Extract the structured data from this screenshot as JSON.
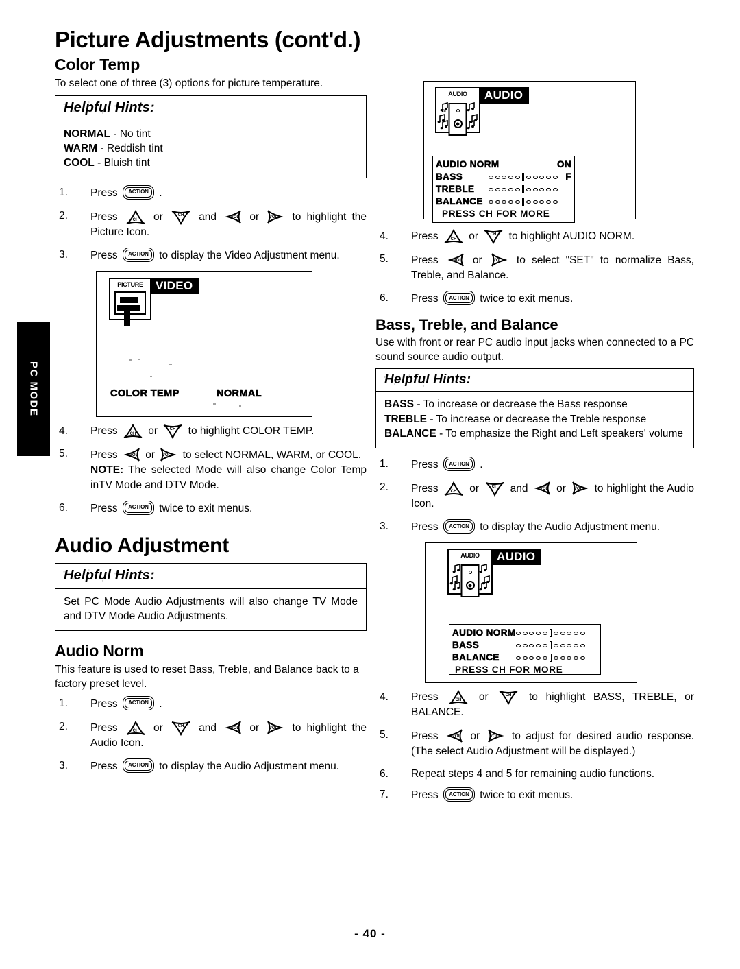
{
  "page": {
    "title": "Picture Adjustments (cont'd.)",
    "number": "- 40 -",
    "side_tab": "PC MODE"
  },
  "color_temp": {
    "heading": "Color Temp",
    "intro": "To select one of three (3) options for picture temperature.",
    "hints": {
      "title": "Helpful Hints:",
      "lines": [
        {
          "term": "NORMAL",
          "dash": "-",
          "desc": "No tint"
        },
        {
          "term": "WARM",
          "dash": "-",
          "desc": "Reddish tint"
        },
        {
          "term": "COOL",
          "dash": "-",
          "desc": "Bluish tint"
        }
      ]
    },
    "steps": [
      {
        "num": "1.",
        "pre": "Press",
        "icons": [
          "action"
        ],
        "post": "."
      },
      {
        "num": "2.",
        "pre": "Press",
        "icons": [
          "ch-up",
          "or",
          "ch-down",
          "and",
          "vol-left",
          "or",
          "vol-right"
        ],
        "post": "to highlight the Picture Icon."
      },
      {
        "num": "3.",
        "pre": "Press",
        "icons": [
          "action"
        ],
        "post": "to display the Video Adjustment menu."
      },
      {
        "num": "4.",
        "pre": "Press",
        "icons": [
          "ch-up",
          "or",
          "ch-down"
        ],
        "post": "to highlight COLOR TEMP."
      },
      {
        "num": "5.",
        "pre": "Press",
        "icons": [
          "vol-left",
          "or",
          "vol-right"
        ],
        "post": "to select NORMAL, WARM, or COOL.",
        "note_label": "NOTE:",
        "note": "The selected Mode will also change Color Temp inTV Mode and DTV Mode."
      },
      {
        "num": "6.",
        "pre": "Press",
        "icons": [
          "action"
        ],
        "post": "twice to exit menus."
      }
    ]
  },
  "video_menu": {
    "icon_caption": "PICTURE",
    "menu_title": "VIDEO",
    "item_label": "COLOR TEMP",
    "item_value": "NORMAL"
  },
  "audio_menu_1": {
    "icon_caption": "AUDIO",
    "menu_title": "AUDIO",
    "rows": [
      {
        "label": "AUDIO NORM",
        "bar": false,
        "value": "ON"
      },
      {
        "label": "BASS",
        "bar": true,
        "value": "F"
      },
      {
        "label": "TREBLE",
        "bar": true,
        "value": ""
      },
      {
        "label": "BALANCE",
        "bar": true,
        "value": ""
      }
    ],
    "footer": "PRESS  CH  FOR MORE"
  },
  "audio_menu_2": {
    "icon_caption": "AUDIO",
    "menu_title": "AUDIO",
    "rows": [
      {
        "label": "AUDIO NORM",
        "bar": true
      },
      {
        "label": "BASS",
        "bar": true
      },
      {
        "label": "BALANCE",
        "bar": true
      }
    ],
    "footer": "PRESS  CH  FOR MORE"
  },
  "audio_norm_right_steps": [
    {
      "num": "4.",
      "pre": "Press",
      "icons": [
        "ch-up",
        "or",
        "ch-down"
      ],
      "post": "to highlight AUDIO NORM."
    },
    {
      "num": "5.",
      "pre": "Press",
      "icons": [
        "vol-left",
        "or",
        "vol-right"
      ],
      "post": "to select \"SET\" to normalize Bass, Treble, and Balance."
    },
    {
      "num": "6.",
      "pre": "Press",
      "icons": [
        "action"
      ],
      "post": "twice to exit menus."
    }
  ],
  "bass_treble_balance": {
    "heading": "Bass, Treble, and Balance",
    "intro": "Use with front or rear PC audio input jacks when connected to a PC sound source audio output.",
    "hints": {
      "title": "Helpful Hints:",
      "lines": [
        {
          "term": "BASS",
          "dash": "-",
          "desc": "To increase or decrease the Bass response"
        },
        {
          "term": "TREBLE",
          "dash": "-",
          "desc": "To increase or decrease the Treble response"
        },
        {
          "term": "BALANCE",
          "dash": "-",
          "desc": "To emphasize the Right and Left speakers' volume"
        }
      ]
    },
    "steps_top": [
      {
        "num": "1.",
        "pre": "Press",
        "icons": [
          "action"
        ],
        "post": "."
      },
      {
        "num": "2.",
        "pre": "Press",
        "icons": [
          "ch-up",
          "or",
          "ch-down",
          "and",
          "vol-left",
          "or",
          "vol-right"
        ],
        "post": "to highlight the Audio Icon."
      },
      {
        "num": "3.",
        "pre": "Press",
        "icons": [
          "action"
        ],
        "post": "to display the Audio Adjustment menu."
      }
    ],
    "steps_bottom": [
      {
        "num": "4.",
        "pre": "Press",
        "icons": [
          "ch-up",
          "or",
          "ch-down"
        ],
        "post": "to highlight BASS, TREBLE, or BALANCE."
      },
      {
        "num": "5.",
        "pre": "Press",
        "icons": [
          "vol-left",
          "or",
          "vol-right"
        ],
        "post": "to adjust  for desired audio response. (The select Audio Adjustment will be displayed.)"
      },
      {
        "num": "6.",
        "plain": "Repeat steps 4 and 5 for remaining audio functions."
      },
      {
        "num": "7.",
        "pre": "Press",
        "icons": [
          "action"
        ],
        "post": "twice to exit menus."
      }
    ]
  },
  "audio_adjustment": {
    "heading": "Audio Adjustment",
    "hints": {
      "title": "Helpful Hints:",
      "text": "Set PC Mode Audio Adjustments will also change TV Mode and DTV Mode Audio Adjustments."
    },
    "audio_norm": {
      "heading": "Audio Norm",
      "intro": "This feature is used to reset Bass, Treble, and Balance back to a factory preset level.",
      "steps": [
        {
          "num": "1.",
          "pre": "Press",
          "icons": [
            "action"
          ],
          "post": "."
        },
        {
          "num": "2.",
          "pre": "Press",
          "icons": [
            "ch-up",
            "or",
            "ch-down",
            "and",
            "vol-left",
            "or",
            "vol-right"
          ],
          "post": "to highlight the Audio Icon."
        },
        {
          "num": "3.",
          "pre": "Press",
          "icons": [
            "action"
          ],
          "post": "to display the Audio Adjustment menu."
        }
      ]
    }
  },
  "icon_labels": {
    "action": "ACTION",
    "ch": "CH",
    "vol": "VOL",
    "or": "or",
    "and": "and"
  }
}
